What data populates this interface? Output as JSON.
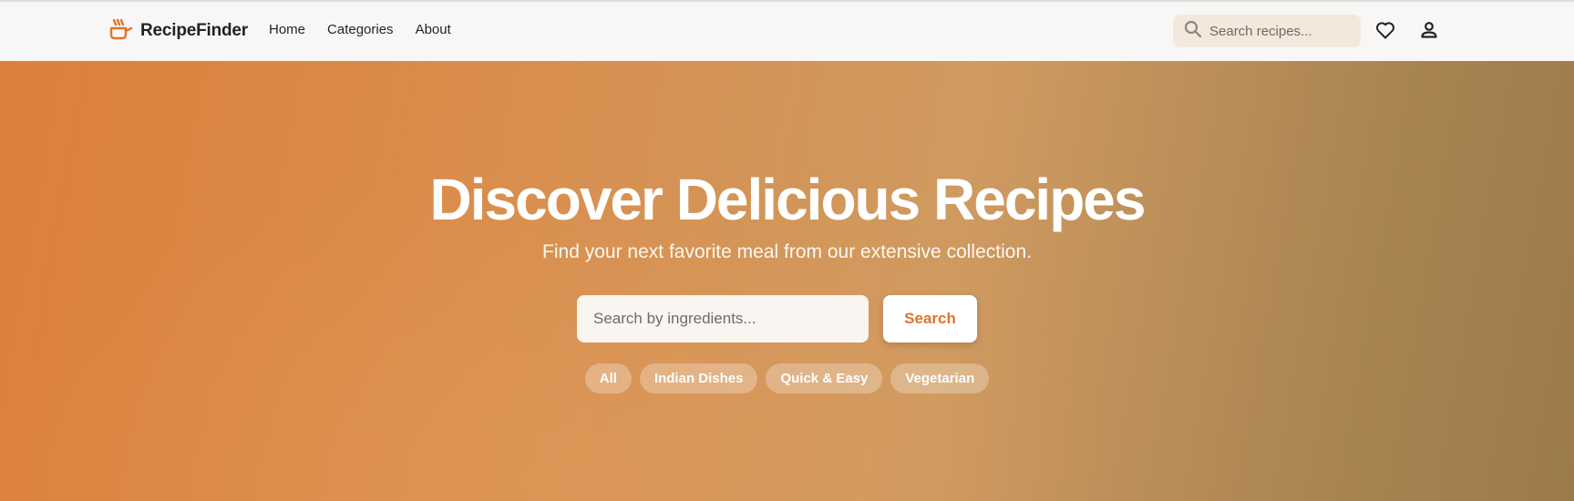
{
  "navbar": {
    "brand": "RecipeFinder",
    "links": [
      {
        "label": "Home"
      },
      {
        "label": "Categories"
      },
      {
        "label": "About"
      }
    ],
    "search_placeholder": "Search recipes...",
    "icons": [
      "cooking-pot-icon",
      "search-icon",
      "heart-icon",
      "user-icon"
    ]
  },
  "hero": {
    "title": "Discover Delicious Recipes",
    "subtitle": "Find your next favorite meal from our extensive collection.",
    "search_placeholder": "Search by ingredients...",
    "search_button": "Search",
    "filters": [
      {
        "label": "All"
      },
      {
        "label": "Indian Dishes"
      },
      {
        "label": "Quick & Easy"
      },
      {
        "label": "Vegetarian"
      }
    ]
  },
  "colors": {
    "accent": "#e0742a",
    "hero_start": "#dc7f3c",
    "hero_end": "#9b7a4b",
    "navbar_bg": "#f9f7f5",
    "search_bg": "#f4e8dd"
  }
}
